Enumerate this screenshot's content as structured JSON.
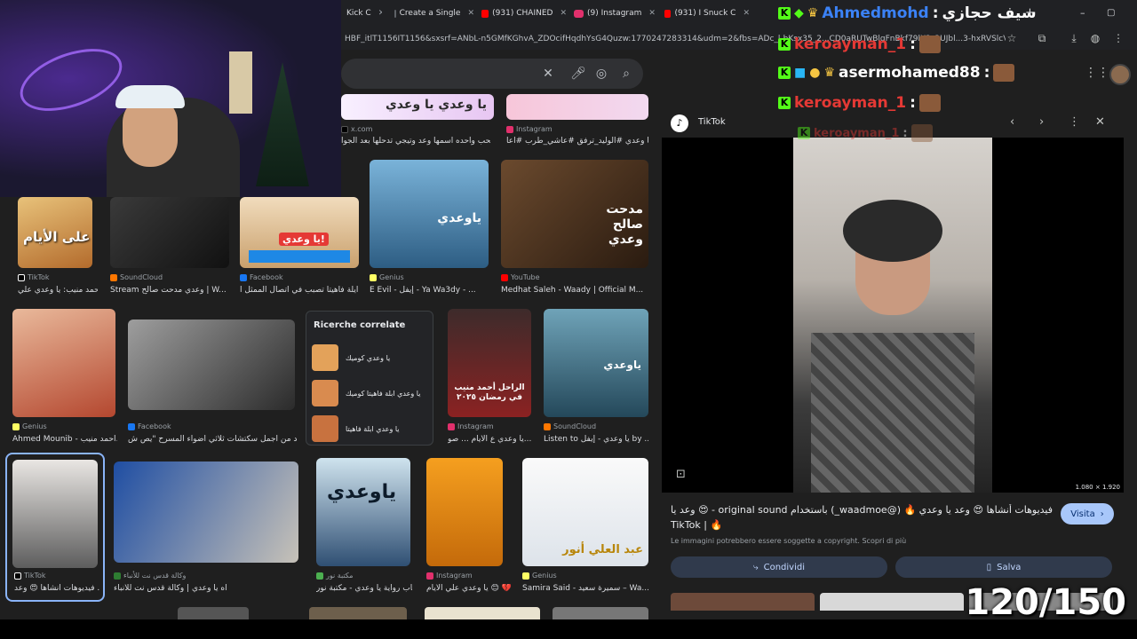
{
  "browser": {
    "tabs": [
      {
        "label": "Kick C",
        "color": "#53fc18"
      },
      {
        "label": "Create a Single",
        "color": "#9aa0a6"
      },
      {
        "label": "(931) CHAINED",
        "color": "#ff0000"
      },
      {
        "label": "(9) Instagram",
        "color": "#e1306c"
      },
      {
        "label": "(931) I Snuck C",
        "color": "#ff0000"
      }
    ],
    "new_tab": "+",
    "url": "HBF_itlT1156IT1156&sxsrf=ANbL-n5GMfKGhvA_ZDOcifHqdhYsG4Quzw:1770247283314&udm=2&fbs=ADc_l-bKsx35_2...CD0aRUTwBlgFnBkf79lX3_2UJbl...3-hxRVSlcVm4S...",
    "window_controls": [
      "–",
      "▢",
      "✕"
    ]
  },
  "results": {
    "row0": [
      {
        "source": "x.com",
        "title": "لما تحب واحده اسمها وعد وتيجي تدحلها بعد الجوا...",
        "overlay": "يا وعدي يا وعدي"
      },
      {
        "source": "Instagram",
        "title": "اه يا وعدي #الوليد_ترفق #عاشي_طرب #اعا...",
        "overlay": ""
      }
    ],
    "row1": [
      {
        "source": "TikTok",
        "title": "أحمد منيب: يا وعدي علي...",
        "overlay": "يا وعدي على الأيام",
        "color": "#ffffff"
      },
      {
        "source": "SoundCloud",
        "title": "Stream وعدي مدحت صالح | W...",
        "overlay": "",
        "color": "#ff7700"
      },
      {
        "source": "Facebook",
        "title": "آيلة فاهيتا تصبب في اتصال الممثل ا...",
        "overlay": "يا وعدي!",
        "color": "#1877f2"
      },
      {
        "source": "Genius",
        "title": "E Evil - إيفل - Ya Wa3dy - ...",
        "overlay": "ياوعدي",
        "color": "#ffff64"
      },
      {
        "source": "YouTube",
        "title": "Medhat Saleh - Waady | Official M...",
        "overlay": "مدحت صالح وعدي",
        "color": "#ff0000"
      }
    ],
    "row2": [
      {
        "source": "Genius",
        "title": "Ahmed Mounib - أحمد منيب...",
        "overlay": "",
        "color": "#ffff64"
      },
      {
        "source": "Facebook",
        "title": "واحد من أجمل سكتشات ثلاثي أضواء المسرح \"يص ش...",
        "overlay": "",
        "color": "#1877f2"
      },
      {
        "source": "Instagram",
        "title": "يا وعدي ع الأيام ... صو...",
        "overlay": "الراحل أحمد منيب في رمضان ٢٠٢٥",
        "color": "#e1306c"
      },
      {
        "source": "SoundCloud",
        "title": "Listen to يا وعدي - إيفل by ...",
        "overlay": "ياوعدي",
        "color": "#ff7700"
      }
    ],
    "related": {
      "heading": "Ricerche correlate",
      "items": [
        "يا وعدي كوميك",
        "يا وعدي ابلة فاهيتا كوميك",
        "يا وعدي ابلة فاهيتا"
      ]
    },
    "row3": [
      {
        "source": "TikTok",
        "title": "فيديوهات أنشاها 😍 وعد ...",
        "overlay": "",
        "color": "#ffffff"
      },
      {
        "source": "وكالة قدس نت للأنباء",
        "title": "آه يا وعدي | وكالة قدس نت للأنباء",
        "overlay": "",
        "color": "#2e7d32"
      },
      {
        "source": "مكتبة نور",
        "title": "كتاب رواية يا وعدي - مكتبة نور",
        "overlay": "ياوعدي",
        "color": "#4caf50"
      },
      {
        "source": "Instagram",
        "title": "يا وعدي علي الأيام 😊 💔",
        "overlay": "",
        "color": "#e1306c"
      },
      {
        "source": "Genius",
        "title": "Samira Said - سميرة سعيد – Wa...",
        "overlay": "عبد العلي أنور",
        "color": "#ffff64"
      }
    ]
  },
  "detail": {
    "site": "TikTok",
    "resolution": "1.080 × 1.920",
    "title": "فيديوهات أنشاها 😍 وعد يا وعدي 🔥 (@waadmoe_) باستخدام original sound - 😍 وعد يا وعدي",
    "title_suffix": "TikTok | 🔥",
    "visit": "Visita",
    "notice": "Le immagini potrebbero essere soggette a copyright. Scopri di più",
    "share": "Condividi",
    "save": "Salva"
  },
  "chat": [
    {
      "user": "Ahmedmohd",
      "msg": "سيف حجازي",
      "color": "#3b82f6"
    },
    {
      "user": "keroayman_1",
      "msg": "",
      "color": "#e53935"
    },
    {
      "user": "asermohamed88",
      "msg": "",
      "color": "#ffffff"
    },
    {
      "user": "keroayman_1",
      "msg": "",
      "color": "#e53935"
    },
    {
      "user": "keroayman_1",
      "msg": "",
      "color": "#e53935"
    }
  ],
  "counter": "120/150",
  "colors": {
    "accent": "#8ab4f8",
    "kick": "#53fc18"
  }
}
